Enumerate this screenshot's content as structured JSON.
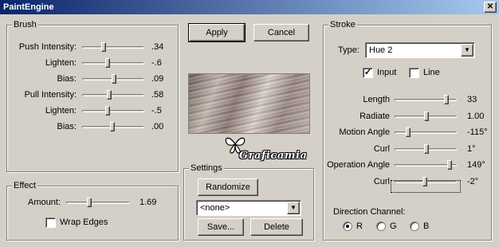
{
  "window": {
    "title": "PaintEngine",
    "close_glyph": "✕"
  },
  "brush": {
    "title": "Brush",
    "sliders": [
      {
        "label": "Push Intensity:",
        "value": ".34",
        "fraction": 0.34
      },
      {
        "label": "Lighten:",
        "value": "-.6",
        "fraction": 0.4
      },
      {
        "label": "Bias:",
        "value": ".09",
        "fraction": 0.52
      },
      {
        "label": "Pull Intensity:",
        "value": ".58",
        "fraction": 0.43
      },
      {
        "label": "Lighten:",
        "value": "-.5",
        "fraction": 0.4
      },
      {
        "label": "Bias:",
        "value": ".00",
        "fraction": 0.48
      }
    ]
  },
  "effect": {
    "title": "Effect",
    "amount_label": "Amount:",
    "amount_value": "1.69",
    "amount_fraction": 0.35,
    "wrap_label": "Wrap Edges",
    "wrap_checked": false
  },
  "buttons": {
    "apply": "Apply",
    "cancel": "Cancel"
  },
  "watermark": "Graficamia",
  "settings": {
    "title": "Settings",
    "randomize": "Randomize",
    "preset_value": "<none>",
    "save": "Save...",
    "delete": "Delete"
  },
  "stroke": {
    "title": "Stroke",
    "type_label": "Type:",
    "type_value": "Hue 2",
    "input_label": "Input",
    "input_checked": true,
    "line_label": "Line",
    "line_checked": false,
    "sliders": [
      {
        "label": "Length",
        "value": "33",
        "fraction": 0.86
      },
      {
        "label": "Radiate",
        "value": "1.00",
        "fraction": 0.52
      },
      {
        "label": "Motion Angle",
        "value": "-115°",
        "fraction": 0.2
      },
      {
        "label": "Curl",
        "value": "1°",
        "fraction": 0.52
      },
      {
        "label": "Operation Angle",
        "value": "149°",
        "fraction": 0.92
      },
      {
        "label": "Curl",
        "value": "-2°",
        "fraction": 0.48
      }
    ],
    "direction_label": "Direction Channel:",
    "channels": [
      {
        "label": "R",
        "selected": true
      },
      {
        "label": "G",
        "selected": false
      },
      {
        "label": "B",
        "selected": false
      }
    ]
  },
  "glyphs": {
    "check": "✓",
    "arrow": "▼"
  },
  "colors": {
    "face": "#d4d0c8",
    "title_start": "#0a246a",
    "title_end": "#a6caf0"
  }
}
